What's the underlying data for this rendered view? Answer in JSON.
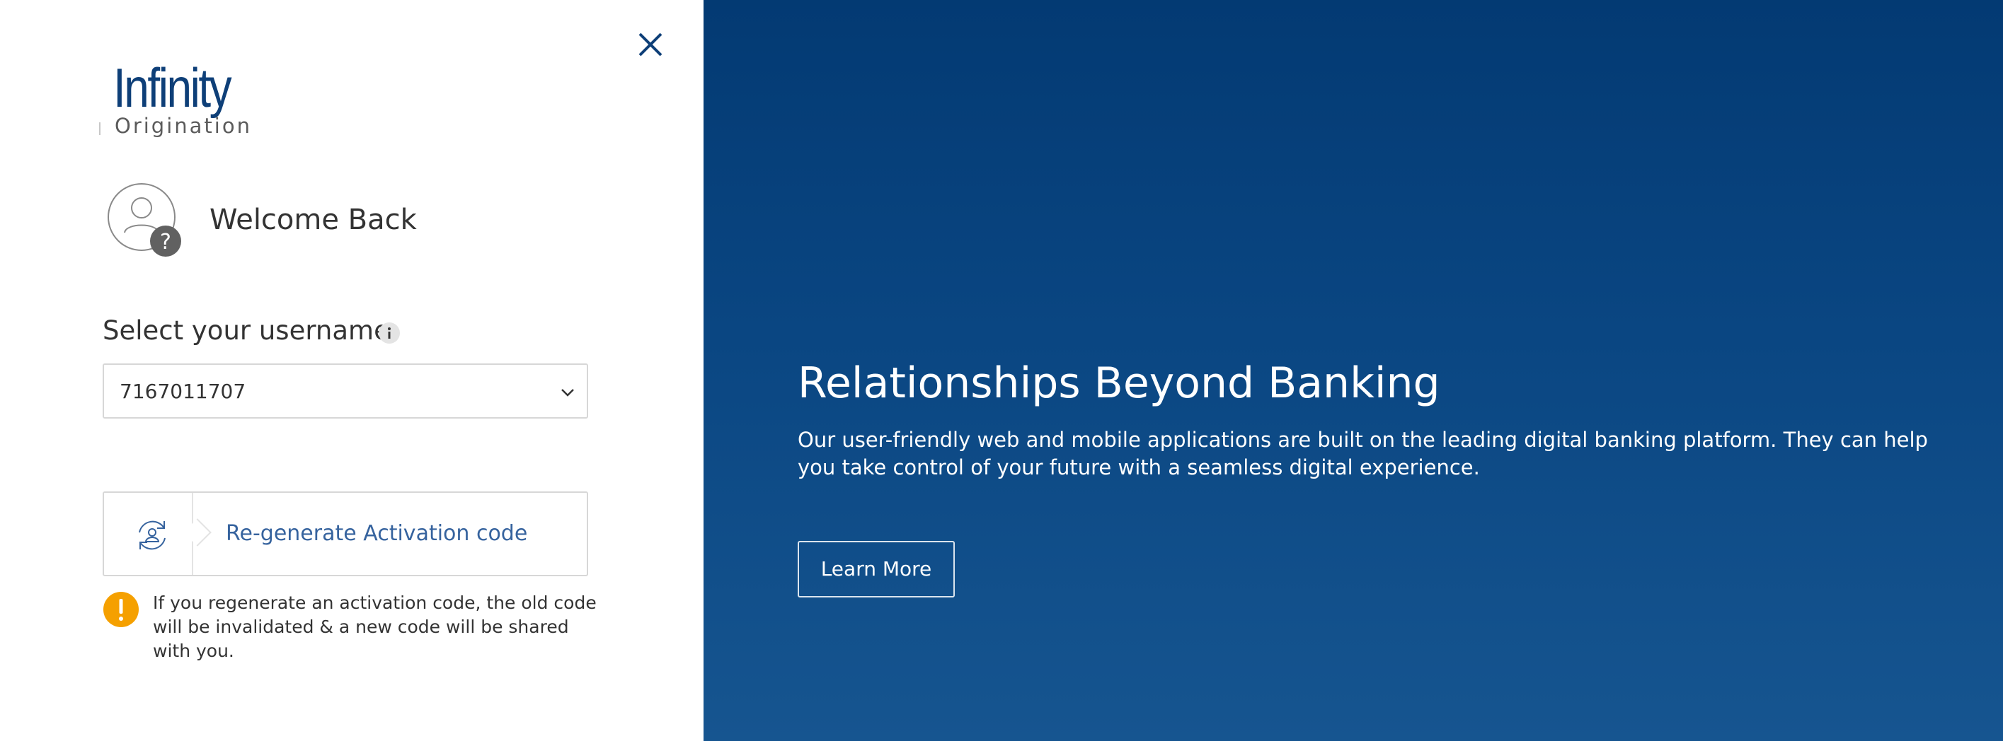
{
  "brand": {
    "logo_top": "Infinity",
    "logo_bottom": "Origination"
  },
  "icons": {
    "close": "close-icon",
    "avatar": "user-question-icon",
    "info": "info-icon",
    "chevron": "chevron-down-icon",
    "regenerate": "refresh-user-icon",
    "warning": "warning-icon"
  },
  "login": {
    "welcome": "Welcome Back",
    "username_label": "Select your username",
    "selected_username": "7167011707",
    "regenerate_label": "Re-generate Activation code",
    "warning_text": "If you regenerate an activation code, the old code will be invalidated & a new code will be shared with you."
  },
  "hero": {
    "title": "Relationships Beyond Banking",
    "description": "Our user-friendly web and mobile applications are built on the leading digital banking platform. They can help you take control of your future with a seamless digital experience.",
    "cta_label": "Learn More"
  },
  "colors": {
    "brand_blue": "#0e3f78",
    "panel_blue": "#0a4682",
    "link_blue": "#36639e",
    "warning": "#f5a000"
  }
}
